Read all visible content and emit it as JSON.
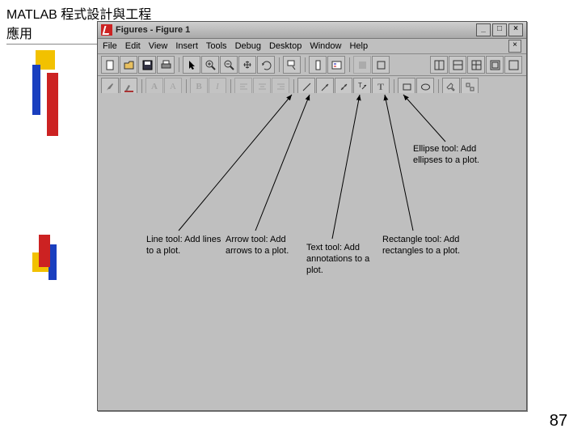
{
  "slide_title": "MATLAB 程式設計與工程應用",
  "page_number": "87",
  "window": {
    "title": "Figures - Figure 1",
    "min": "_",
    "max": "□",
    "close": "×"
  },
  "menu": {
    "file": "File",
    "edit": "Edit",
    "view": "View",
    "insert": "Insert",
    "tools": "Tools",
    "debug": "Debug",
    "desktop": "Desktop",
    "window": "Window",
    "help": "Help",
    "menu_close": "×"
  },
  "annotation": {
    "line": "Line tool: Add lines to a plot.",
    "arrow": "Arrow tool: Add arrows to a plot.",
    "text": "Text tool: Add annotations to a plot.",
    "rect": "Rectangle tool: Add rectangles to a plot.",
    "ellipse": "Ellipse tool: Add ellipses to a plot."
  }
}
